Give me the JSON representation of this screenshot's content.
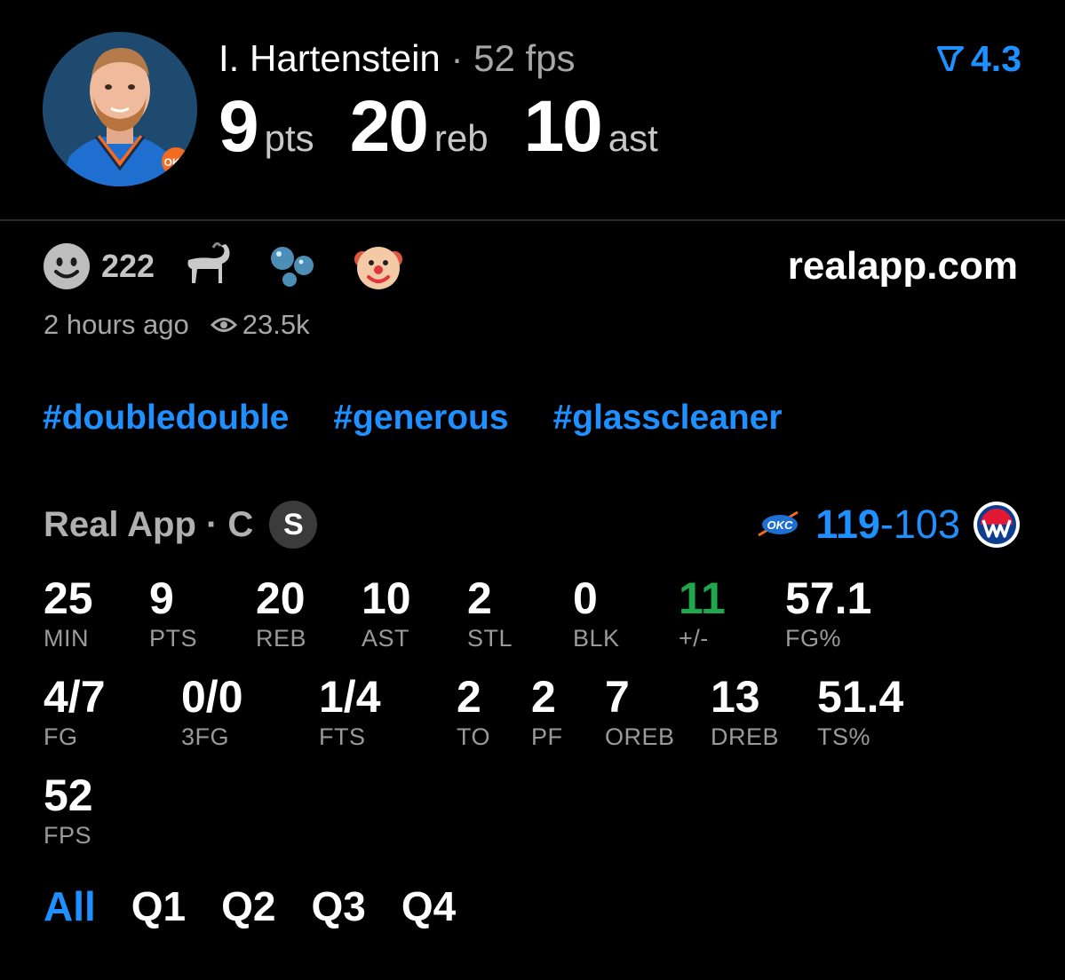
{
  "player": {
    "name": "I. Hartenstein",
    "separator": "·",
    "fps_label": "52 fps",
    "rating": "4.3",
    "headline": [
      {
        "value": "9",
        "unit": "pts"
      },
      {
        "value": "20",
        "unit": "reb"
      },
      {
        "value": "10",
        "unit": "ast"
      }
    ]
  },
  "reactions": {
    "count": "222",
    "icons": [
      "smiley-icon",
      "goat-icon",
      "bubbles-icon",
      "clown-icon"
    ]
  },
  "site": "realapp.com",
  "meta": {
    "time": "2 hours ago",
    "views": "23.5k"
  },
  "tags": [
    "#doubledouble",
    "#generous",
    "#glasscleaner"
  ],
  "game": {
    "source": "Real App · C",
    "badge": "S",
    "home_score": "119",
    "dash": "-",
    "away_score": "103"
  },
  "stats": [
    {
      "value": "25",
      "label": "MIN"
    },
    {
      "value": "9",
      "label": "PTS"
    },
    {
      "value": "20",
      "label": "REB"
    },
    {
      "value": "10",
      "label": "AST"
    },
    {
      "value": "2",
      "label": "STL"
    },
    {
      "value": "0",
      "label": "BLK"
    },
    {
      "value": "11",
      "label": "+/-"
    },
    {
      "value": "57.1",
      "label": "FG%"
    },
    {
      "value": "4/7",
      "label": "FG"
    },
    {
      "value": "0/0",
      "label": "3FG"
    },
    {
      "value": "1/4",
      "label": "FTS"
    },
    {
      "value": "2",
      "label": "TO"
    },
    {
      "value": "2",
      "label": "PF"
    },
    {
      "value": "7",
      "label": "OREB"
    },
    {
      "value": "13",
      "label": "DREB"
    },
    {
      "value": "51.4",
      "label": "TS%"
    },
    {
      "value": "52",
      "label": "FPS"
    }
  ],
  "tabs": [
    "All",
    "Q1",
    "Q2",
    "Q3",
    "Q4"
  ],
  "active_tab": "All",
  "colors": {
    "accent": "#1e90ff",
    "positive": "#1ea84b",
    "background": "#000000"
  }
}
